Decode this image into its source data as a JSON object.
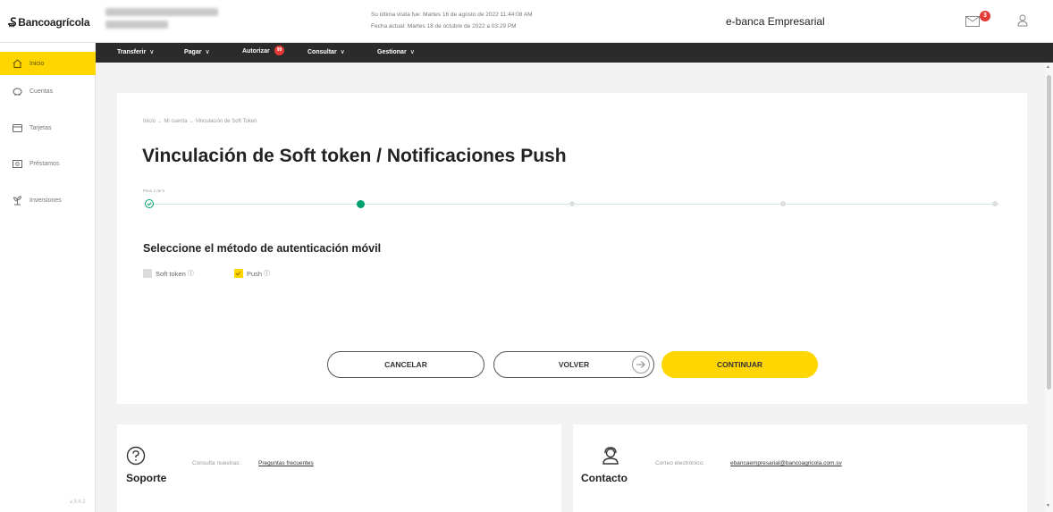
{
  "header": {
    "logo": "Bancoagrícola",
    "last_visit": "Su última visita fue: Martes 16 de agosto de 2022 11:44:08 AM",
    "current_date": "Fecha actual: Martes 18 de octubre de 2022 a 03:29 PM",
    "portal_title": "e-banca Empresarial",
    "mail_badge": "3"
  },
  "sidebar": {
    "items": [
      {
        "label": "Inicio",
        "icon": "home-icon"
      },
      {
        "label": "Cuentas",
        "icon": "piggy-bank-icon"
      },
      {
        "label": "Tarjetas",
        "icon": "card-icon"
      },
      {
        "label": "Préstamos",
        "icon": "loan-icon"
      },
      {
        "label": "Inversiones",
        "icon": "investment-icon"
      }
    ],
    "version": "v.3.4.2"
  },
  "topnav": {
    "items": [
      {
        "label": "Transferir"
      },
      {
        "label": "Pagar"
      },
      {
        "label": "Autorizar",
        "badge": "99"
      },
      {
        "label": "Consultar"
      },
      {
        "label": "Gestionar"
      }
    ]
  },
  "main": {
    "breadcrumb": "Inicio → Mi cuenta → Vinculación de Soft Token",
    "title": "Vinculación de Soft token / Notificaciones Push",
    "step_label": "Paso 2 de 5",
    "current_step": 2,
    "total_steps": 5,
    "section_title": "Seleccione el método de autenticación móvil",
    "options": [
      {
        "label": "Soft token",
        "checked": false
      },
      {
        "label": "Push",
        "checked": true
      }
    ],
    "buttons": {
      "cancel": "CANCELAR",
      "back": "VOLVER",
      "continue": "CONTINUAR"
    }
  },
  "support": {
    "title": "Soporte",
    "text": "Consulta nuestras:",
    "link": "Preguntas frecuentes"
  },
  "contact": {
    "title": "Contacto",
    "text": "Correo electrónico:",
    "link": "ebancaempresarial@bancoagricola.com.sv"
  },
  "colors": {
    "accent": "#ffd600",
    "nav_bg": "#2b2b2b",
    "step_green": "#00a06e",
    "badge_red": "#e53935"
  }
}
